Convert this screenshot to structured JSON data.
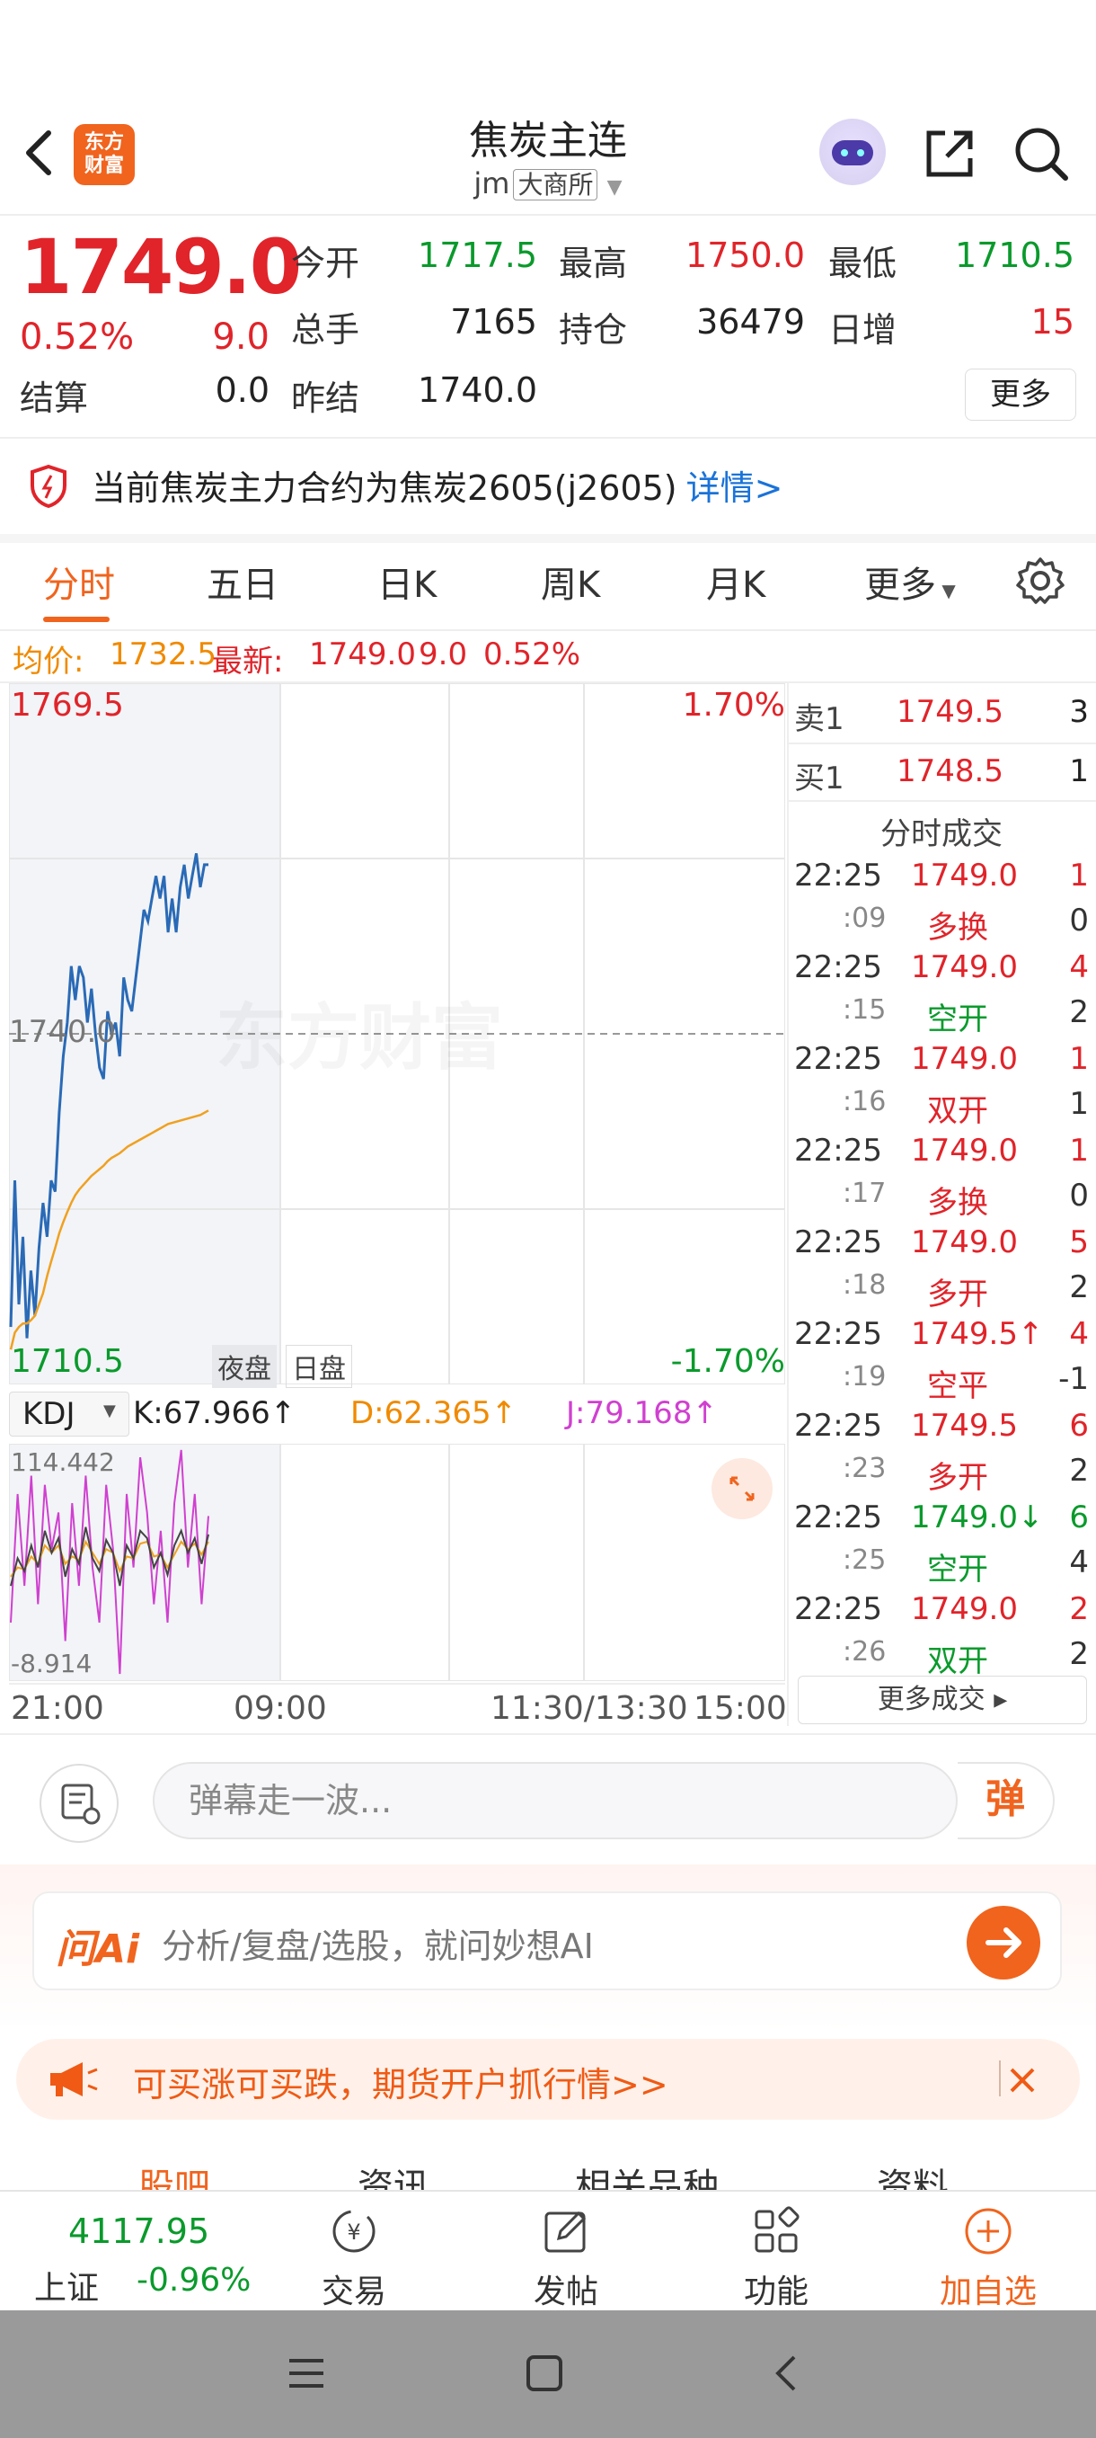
{
  "header": {
    "title": "焦炭主连",
    "code": "jm",
    "exchange": "大商所",
    "logo_line1": "东方",
    "logo_line2": "财富"
  },
  "quote": {
    "price": "1749.0",
    "change_pct": "0.52%",
    "change": "9.0",
    "open_label": "今开",
    "open": "1717.5",
    "high_label": "最高",
    "high": "1750.0",
    "low_label": "最低",
    "low": "1710.5",
    "volume_label": "总手",
    "volume": "7165",
    "oi_label": "持仓",
    "oi": "36479",
    "daily_inc_label": "日增",
    "daily_inc": "15",
    "settle_label": "结算",
    "settle": "0.0",
    "prev_settle_label": "昨结",
    "prev_settle": "1740.0",
    "more_label": "更多"
  },
  "notice": {
    "text": "当前焦炭主力合约为焦炭2605(j2605)",
    "link": "详情>"
  },
  "tabs": [
    "分时",
    "五日",
    "日K",
    "周K",
    "月K",
    "更多"
  ],
  "avg": {
    "avg_label": "均价:",
    "avg": "1732.5",
    "latest_label": "最新:",
    "latest": "1749.0",
    "chg": "9.0",
    "pct": "0.52%"
  },
  "chart": {
    "y_max": "1769.5",
    "y_min": "1710.5",
    "ref": "1740.0",
    "pct_max": "1.70%",
    "pct_min": "-1.70%",
    "watermark": "东方财富",
    "night_label": "夜盘",
    "day_label": "日盘",
    "colors": {
      "price": "#2a6ab6",
      "avg": "#f0a020",
      "kdj_k": "#444444",
      "kdj_d": "#f0a020",
      "kdj_j": "#d040d0"
    }
  },
  "chart_data": {
    "type": "line",
    "title": "",
    "ylim": [
      1710.5,
      1769.5
    ],
    "series": [
      {
        "name": "price",
        "values": [
          1714,
          1727,
          1716,
          1722,
          1713,
          1719,
          1715,
          1721,
          1725,
          1722,
          1727,
          1726,
          1733,
          1738,
          1741,
          1746,
          1743,
          1746,
          1745,
          1741,
          1744,
          1740,
          1737,
          1736,
          1742,
          1740,
          1741,
          1738,
          1745,
          1743,
          1742,
          1745,
          1748,
          1751,
          1750,
          1752,
          1754,
          1752,
          1754,
          1749,
          1752,
          1749,
          1753,
          1755,
          1752,
          1754,
          1756,
          1753,
          1755,
          1755
        ]
      },
      {
        "name": "avg",
        "values": [
          1712,
          1713.5,
          1714,
          1714.3,
          1714.3,
          1714.6,
          1715,
          1716,
          1717,
          1718.5,
          1719.8,
          1721,
          1722.3,
          1723.3,
          1724.2,
          1725,
          1725.7,
          1726.2,
          1726.6,
          1727,
          1727.4,
          1727.7,
          1728,
          1728.3,
          1728.7,
          1729,
          1729.2,
          1729.4,
          1729.7,
          1730,
          1730.2,
          1730.4,
          1730.6,
          1730.8,
          1731,
          1731.2,
          1731.4,
          1731.6,
          1731.8,
          1732,
          1732.1,
          1732.2,
          1732.3,
          1732.4,
          1732.5,
          1732.6,
          1732.7,
          1732.8,
          1733,
          1733.2
        ]
      }
    ]
  },
  "kdj": {
    "name": "KDJ",
    "k": "K:67.966↑",
    "d": "D:62.365↑",
    "j": "J:79.168↑",
    "max": "114.442",
    "min": "-8.914"
  },
  "kdj_data": {
    "k": [
      40,
      55,
      48,
      62,
      50,
      70,
      58,
      66,
      45,
      60,
      52,
      72,
      55,
      48,
      65,
      58,
      40,
      62,
      55,
      70,
      66,
      50,
      58,
      46,
      62,
      70,
      58,
      66,
      52,
      68
    ],
    "d": [
      45,
      50,
      49,
      56,
      52,
      62,
      58,
      62,
      52,
      56,
      54,
      64,
      58,
      52,
      60,
      58,
      48,
      56,
      55,
      63,
      64,
      56,
      57,
      50,
      57,
      64,
      60,
      63,
      57,
      64
    ],
    "j": [
      20,
      90,
      40,
      100,
      30,
      95,
      60,
      80,
      10,
      85,
      40,
      100,
      50,
      20,
      95,
      60,
      -8,
      90,
      50,
      110,
      80,
      30,
      70,
      20,
      85,
      114,
      50,
      90,
      30,
      78
    ]
  },
  "xaxis": [
    "21:00",
    "09:00",
    "11:30/13:30",
    "15:00"
  ],
  "book": {
    "sell_label": "卖1",
    "sell_price": "1749.5",
    "sell_qty": "3",
    "buy_label": "买1",
    "buy_price": "1748.5",
    "buy_qty": "1",
    "trades_title": "分时成交",
    "trades": [
      {
        "time": "22:25",
        "price": "1749.0",
        "qty": "1",
        "sec": ":09",
        "type": "多换",
        "oi": "0",
        "pc": "red",
        "tc": "red"
      },
      {
        "time": "22:25",
        "price": "1749.0",
        "qty": "4",
        "sec": ":15",
        "type": "空开",
        "oi": "2",
        "pc": "red",
        "tc": "green"
      },
      {
        "time": "22:25",
        "price": "1749.0",
        "qty": "1",
        "sec": ":16",
        "type": "双开",
        "oi": "1",
        "pc": "red",
        "tc": "red"
      },
      {
        "time": "22:25",
        "price": "1749.0",
        "qty": "1",
        "sec": ":17",
        "type": "多换",
        "oi": "0",
        "pc": "red",
        "tc": "red"
      },
      {
        "time": "22:25",
        "price": "1749.0",
        "qty": "5",
        "sec": ":18",
        "type": "多开",
        "oi": "2",
        "pc": "red",
        "tc": "red"
      },
      {
        "time": "22:25",
        "price": "1749.5↑",
        "qty": "4",
        "sec": ":19",
        "type": "空平",
        "oi": "-1",
        "pc": "red",
        "tc": "red"
      },
      {
        "time": "22:25",
        "price": "1749.5",
        "qty": "6",
        "sec": ":23",
        "type": "多开",
        "oi": "2",
        "pc": "red",
        "tc": "red"
      },
      {
        "time": "22:25",
        "price": "1749.0↓",
        "qty": "6",
        "sec": ":25",
        "type": "空开",
        "oi": "4",
        "pc": "green",
        "tc": "green"
      },
      {
        "time": "22:25",
        "price": "1749.0",
        "qty": "2",
        "sec": ":26",
        "type": "双开",
        "oi": "2",
        "pc": "red",
        "tc": "green"
      }
    ],
    "more_trades": "更多成交 ▸"
  },
  "comment": {
    "placeholder": "弹幕走一波...",
    "danmu": "弹"
  },
  "ai": {
    "logo": "问Ai",
    "text": "分析/复盘/选股，就问妙想AI"
  },
  "promo": {
    "text": "可买涨可买跌，期货开户抓行情>>"
  },
  "subtabs": [
    "股吧",
    "资讯",
    "相关品种",
    "资料"
  ],
  "bottomnav": {
    "index_value": "4117.95",
    "index_name": "上证",
    "index_pct": "-0.96%",
    "items": [
      "交易",
      "发帖",
      "功能",
      "加自选"
    ]
  }
}
